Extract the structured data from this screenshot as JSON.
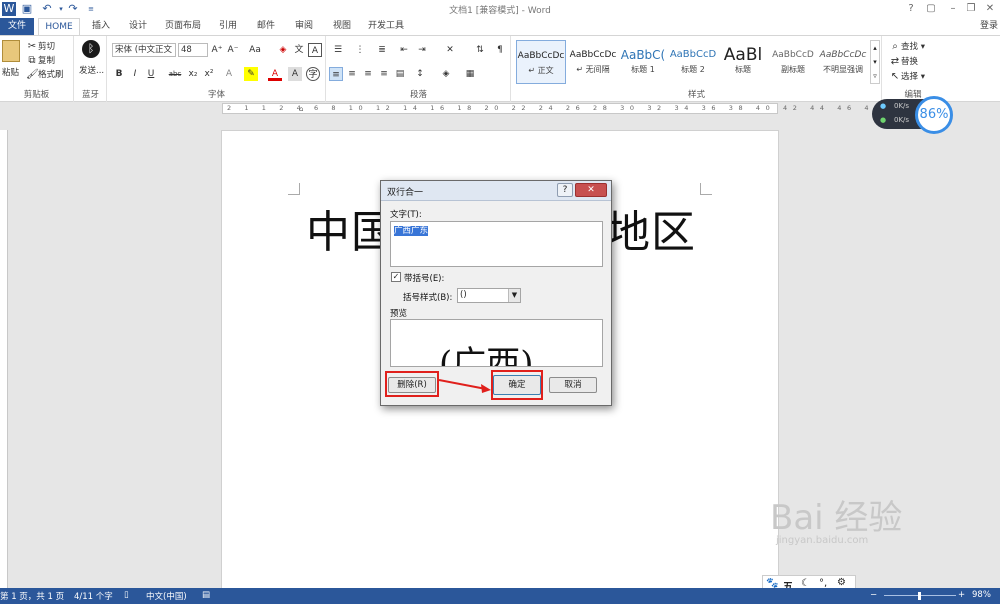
{
  "titlebar": {
    "title": "文档1 [兼容模式] - Word",
    "help": "?",
    "login": "登录"
  },
  "tabs": [
    "文件",
    "HOME",
    "插入",
    "设计",
    "页面布局",
    "引用",
    "邮件",
    "审阅",
    "视图",
    "开发工具"
  ],
  "ribbon": {
    "clipboard": {
      "paste": "粘贴",
      "cut": "剪切",
      "copy": "复制",
      "format_painter": "格式刷",
      "label": "剪贴板"
    },
    "bluetooth": {
      "send": "发送...",
      "label": "蓝牙"
    },
    "font": {
      "name": "宋体 (中文正文",
      "size": "48",
      "label": "字体",
      "aa": "Aa",
      "bold": "B",
      "italic": "I",
      "underline": "U",
      "strike": "abc",
      "sub": "x₂",
      "sup": "x²"
    },
    "paragraph": {
      "label": "段落"
    },
    "styles": {
      "label": "样式",
      "items": [
        {
          "sample": "AaBbCcDc",
          "name": "↵ 正文"
        },
        {
          "sample": "AaBbCcDc",
          "name": "↵ 无间隔"
        },
        {
          "sample": "AaBbC(",
          "name": "标题 1"
        },
        {
          "sample": "AaBbCcD",
          "name": "标题 2"
        },
        {
          "sample": "AaBl",
          "name": "标题"
        },
        {
          "sample": "AaBbCcD",
          "name": "副标题"
        },
        {
          "sample": "AaBbCcDc",
          "name": "不明显强调"
        }
      ]
    },
    "editing": {
      "find": "查找",
      "replace": "替换",
      "select": "选择",
      "label": "编辑"
    }
  },
  "ruler": "2 1 1 2 4 6 8 10 12 14 16 18 20 22 24 26 28 30 32 34 36 38 40 42 44 46 48 50",
  "document": {
    "text_left": "中国",
    "text_right": "地区"
  },
  "dialog": {
    "title": "双行合一",
    "text_label": "文字(T):",
    "text_value": "广西广东",
    "bracket_checkbox": "带括号(E):",
    "bracket_checked": true,
    "bracket_style_label": "括号样式(B):",
    "bracket_style_value": "()",
    "preview_label": "预览",
    "preview_text": "(广西)",
    "delete_button": "删除(R)",
    "ok_button": "确定",
    "cancel_button": "取消"
  },
  "status": {
    "page": "第 1 页，共 1 页",
    "words": "4/11 个字",
    "lang": "中文(中国)",
    "zoom": "98%"
  },
  "widget": {
    "up": "0K/s",
    "down": "0K/s",
    "percent": "86%"
  },
  "watermark": {
    "brand": "Bai 经验",
    "url": "jingyan.baidu.com"
  },
  "ime": {
    "label": "五"
  },
  "colors": {
    "accent": "#2b579a",
    "highlight": "#e0201c"
  }
}
